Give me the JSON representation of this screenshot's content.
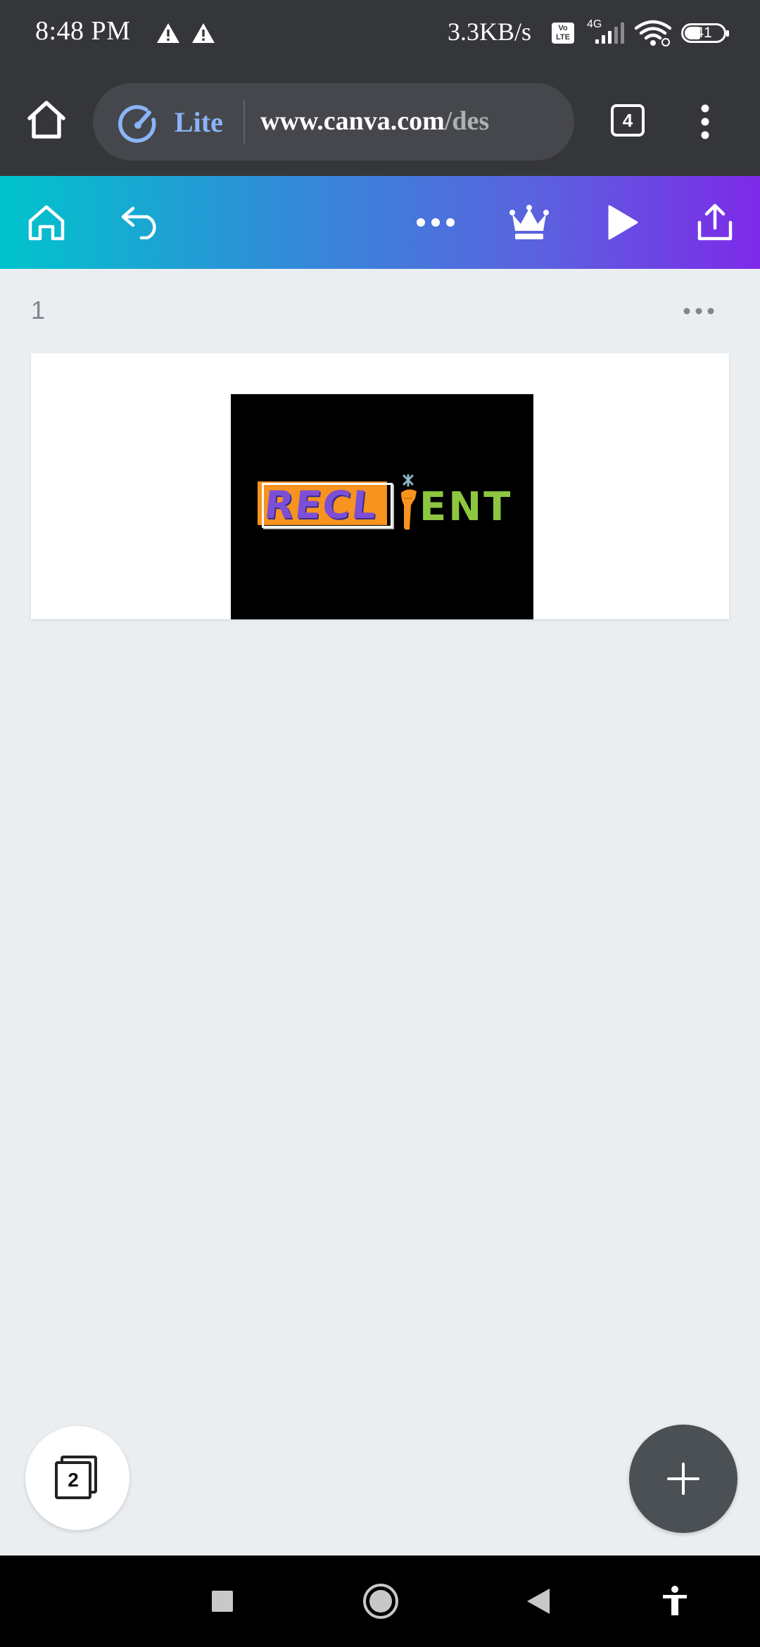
{
  "status_bar": {
    "time": "8:48 PM",
    "speed": "3.3KB/s",
    "volte": "Vo LTE",
    "network": "4G",
    "battery": "41"
  },
  "browser": {
    "mode_label": "Lite",
    "url_domain": "www.canva.com",
    "url_path": "/des",
    "tab_count": "4"
  },
  "editor": {
    "page_number": "1",
    "design_logo": {
      "left_text": "RECL",
      "right_text": "ENT"
    },
    "pages_count": "2"
  },
  "colors": {
    "toolbar_gradient_start": "#00c4cc",
    "toolbar_gradient_end": "#7d2ae8",
    "logo_orange": "#f7931e",
    "logo_purple": "#7d4fd6",
    "logo_green": "#8dc63f"
  },
  "icons": {
    "status": [
      "warning-icon",
      "warning-icon",
      "signal-icon",
      "wifi-icon",
      "battery-icon"
    ],
    "browser": [
      "home-icon",
      "lite-speed-icon",
      "tabs-icon",
      "more-vert-icon"
    ],
    "toolbar": [
      "home-icon",
      "undo-icon",
      "more-horiz-icon",
      "crown-icon",
      "play-icon",
      "share-icon"
    ],
    "nav": [
      "recents-icon",
      "home-circle-icon",
      "back-icon",
      "accessibility-icon"
    ]
  }
}
